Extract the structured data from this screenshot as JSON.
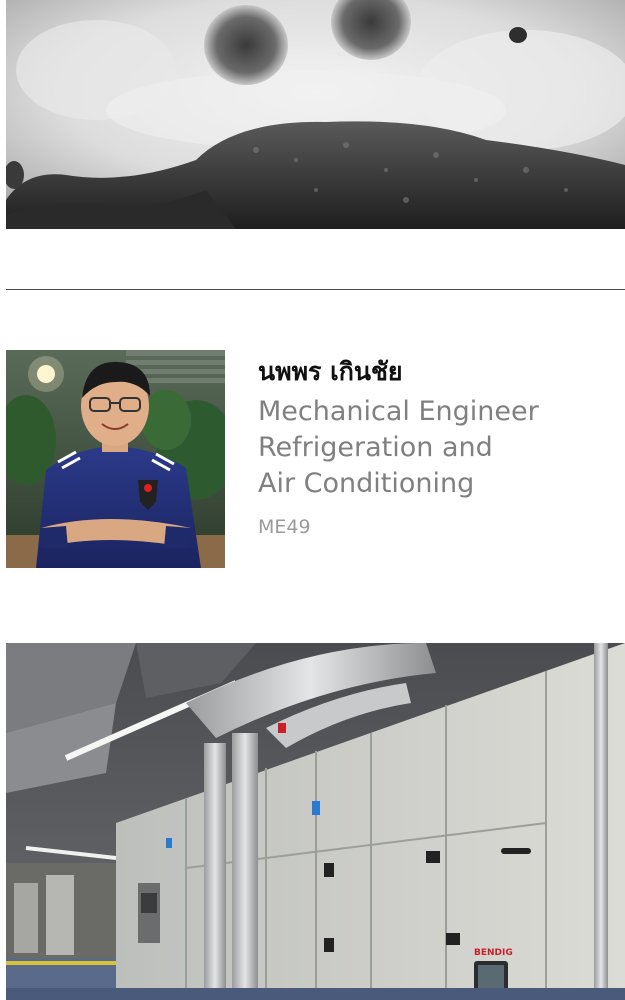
{
  "profile": {
    "name": "นพพร เกินชัย",
    "role_line1": "Mechanical Engineer",
    "role_line2": "Refrigeration and",
    "role_line3": "Air Conditioning",
    "code": "ME49"
  },
  "equipment_image": {
    "brand_label": "BENDIG"
  },
  "colors": {
    "divider": "#4a4a4a",
    "name_text": "#111111",
    "role_text": "#808080",
    "code_text": "#9a9a9a",
    "brand_red": "#c8202a"
  }
}
